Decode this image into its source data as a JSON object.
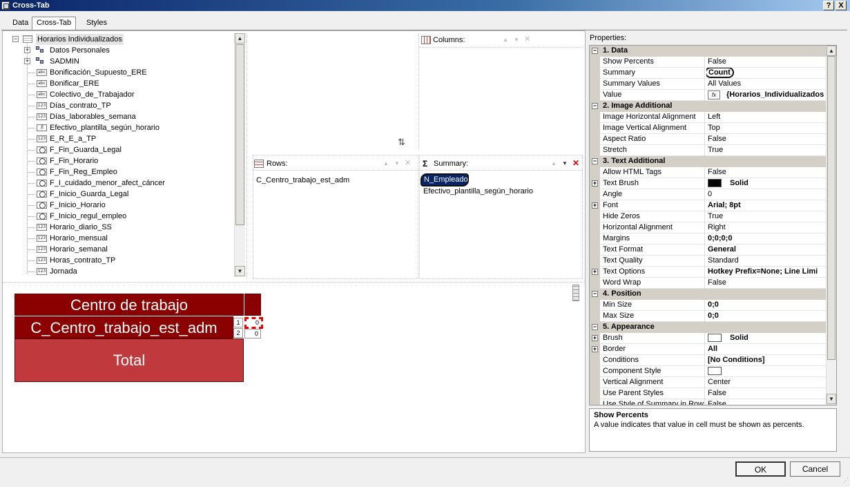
{
  "window": {
    "title": "Cross-Tab",
    "help_button": "?",
    "close_button": "X"
  },
  "tabs": [
    {
      "label": "Data"
    },
    {
      "label": "Cross-Tab"
    },
    {
      "label": "Styles"
    }
  ],
  "tree": {
    "root": "Horarios Individualizados",
    "groups": [
      "Datos Personales",
      "SADMIN"
    ],
    "fields": [
      {
        "label": "Bonificación_Supuesto_ERE",
        "icon": "text-field-icon",
        "glyph": "abc"
      },
      {
        "label": "Bonificar_ERE",
        "icon": "text-field-icon",
        "glyph": "abc"
      },
      {
        "label": "Colectivo_de_Trabajador",
        "icon": "text-field-icon",
        "glyph": "abc"
      },
      {
        "label": "Días_contrato_TP",
        "icon": "number-field-icon",
        "glyph": "123"
      },
      {
        "label": "Días_laborables_semana",
        "icon": "number-field-icon",
        "glyph": "123"
      },
      {
        "label": "Efectivo_plantilla_según_horario",
        "icon": "decimal-field-icon",
        "glyph": ".E"
      },
      {
        "label": "E_R_E_a_TP",
        "icon": "number-field-icon",
        "glyph": "123"
      },
      {
        "label": "F_Fin_Guarda_Legal",
        "icon": "datetime-field-icon",
        "glyph": ""
      },
      {
        "label": "F_Fin_Horario",
        "icon": "datetime-field-icon",
        "glyph": ""
      },
      {
        "label": "F_Fin_Reg_Empleo",
        "icon": "datetime-field-icon",
        "glyph": ""
      },
      {
        "label": "F_I_cuidado_menor_afect_cáncer",
        "icon": "datetime-field-icon",
        "glyph": ""
      },
      {
        "label": "F_Inicio_Guarda_Legal",
        "icon": "datetime-field-icon",
        "glyph": ""
      },
      {
        "label": "F_Inicio_Horario",
        "icon": "datetime-field-icon",
        "glyph": ""
      },
      {
        "label": "F_Inicio_regul_empleo",
        "icon": "datetime-field-icon",
        "glyph": ""
      },
      {
        "label": "Horario_diario_SS",
        "icon": "number-field-icon",
        "glyph": "123"
      },
      {
        "label": "Horario_mensual",
        "icon": "number-field-icon",
        "glyph": "123"
      },
      {
        "label": "Horario_semanal",
        "icon": "number-field-icon",
        "glyph": "123"
      },
      {
        "label": "Horas_contrato_TP",
        "icon": "number-field-icon",
        "glyph": "123"
      },
      {
        "label": "Jornada",
        "icon": "number-field-icon",
        "glyph": "123"
      }
    ]
  },
  "zones": {
    "columns": {
      "label": "Columns:",
      "items": []
    },
    "rows": {
      "label": "Rows:",
      "items": [
        "C_Centro_trabajo_est_adm"
      ]
    },
    "summary": {
      "label": "Summary:",
      "sigma": "Σ",
      "items": [
        "N_Empleado",
        "Efectivo_plantilla_según_horario"
      ]
    }
  },
  "preview": {
    "header": "Centro de trabajo",
    "row_header": "C_Centro_trabajo_est_adm",
    "total": "Total",
    "row_numbers": [
      "1",
      "2"
    ],
    "cells": [
      "0",
      "0"
    ]
  },
  "properties": {
    "label": "Properties:",
    "rows": [
      {
        "type": "cat",
        "label": "1. Data"
      },
      {
        "label": "Show Percents",
        "value": "False"
      },
      {
        "label": "Summary",
        "value": "Count",
        "bold": true,
        "circled": true
      },
      {
        "label": "Summary Values",
        "value": "All Values"
      },
      {
        "label": "Value",
        "value": "{Horarios_Individualizados",
        "bold": true,
        "fx": true
      },
      {
        "type": "cat",
        "label": "2. Image  Additional"
      },
      {
        "label": "Image Horizontal Alignment",
        "value": "Left"
      },
      {
        "label": "Image Vertical Alignment",
        "value": "Top"
      },
      {
        "label": "Aspect Ratio",
        "value": "False"
      },
      {
        "label": "Stretch",
        "value": "True"
      },
      {
        "type": "cat",
        "label": "3. Text  Additional"
      },
      {
        "label": "Allow HTML Tags",
        "value": "False"
      },
      {
        "label": "Text Brush",
        "value": "Solid",
        "bold": true,
        "expand": true,
        "swatch": "#000000"
      },
      {
        "label": "Angle",
        "value": "0"
      },
      {
        "label": "Font",
        "value": "Arial; 8pt",
        "bold": true,
        "expand": true
      },
      {
        "label": "Hide Zeros",
        "value": "True"
      },
      {
        "label": "Horizontal Alignment",
        "value": "Right"
      },
      {
        "label": "Margins",
        "value": "0;0;0;0",
        "bold": true
      },
      {
        "label": "Text Format",
        "value": "General",
        "bold": true
      },
      {
        "label": "Text Quality",
        "value": "Standard"
      },
      {
        "label": "Text Options",
        "value": "Hotkey Prefix=None; Line Limi",
        "bold": true,
        "expand": true
      },
      {
        "label": "Word Wrap",
        "value": "False"
      },
      {
        "type": "cat",
        "label": "4. Position"
      },
      {
        "label": "Min Size",
        "value": "0;0",
        "bold": true
      },
      {
        "label": "Max Size",
        "value": "0;0",
        "bold": true
      },
      {
        "type": "cat",
        "label": "5. Appearance"
      },
      {
        "label": "Brush",
        "value": "Solid",
        "bold": true,
        "expand": true,
        "swatch": "#ffffff"
      },
      {
        "label": "Border",
        "value": "All",
        "bold": true,
        "expand": true
      },
      {
        "label": "Conditions",
        "value": "[No Conditions]",
        "bold": true
      },
      {
        "label": "Component Style",
        "value": "",
        "swatch": "#ffffff"
      },
      {
        "label": "Vertical Alignment",
        "value": "Center"
      },
      {
        "label": "Use Parent Styles",
        "value": "False"
      },
      {
        "label": "Use Style of Summary in Row T",
        "value": "False"
      }
    ]
  },
  "description": {
    "title": "Show Percents",
    "text": "A value indicates that value in cell must be shown as percents."
  },
  "buttons": {
    "ok": "OK",
    "cancel": "Cancel"
  },
  "colors": {
    "dark_red": "#8b0000",
    "total_red": "#c0393c",
    "titlebar": "#0a246a"
  }
}
